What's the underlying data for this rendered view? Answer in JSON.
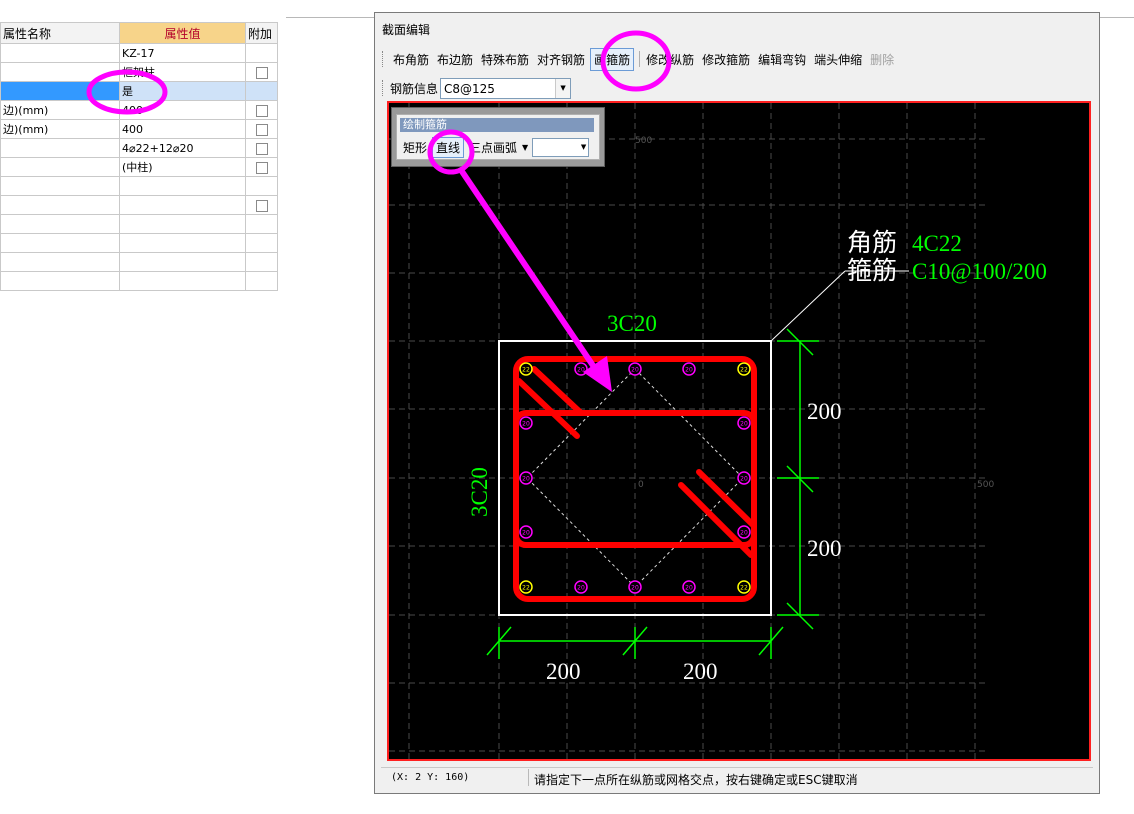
{
  "prop_grid": {
    "headers": {
      "name": "属性名称",
      "value": "属性值",
      "extra": "附加"
    },
    "rows": [
      {
        "name": "",
        "value": "KZ-17",
        "check": false
      },
      {
        "name": "",
        "value": "框架柱",
        "check": true
      },
      {
        "name": "",
        "value": "是",
        "check": false,
        "selected": true
      },
      {
        "name": "边)(mm)",
        "value": "400",
        "check": true
      },
      {
        "name": "边)(mm)",
        "value": "400",
        "check": true
      },
      {
        "name": "",
        "value": "4⌀22+12⌀20",
        "check": true
      },
      {
        "name": "",
        "value": "(中柱)",
        "check": true
      },
      {
        "name": "",
        "value": "",
        "check": false
      },
      {
        "name": "",
        "value": "",
        "check": true
      },
      {
        "name": "",
        "value": "",
        "check": false
      },
      {
        "name": "",
        "value": "",
        "check": false
      },
      {
        "name": "",
        "value": "",
        "check": false
      },
      {
        "name": "",
        "value": "",
        "check": false
      }
    ]
  },
  "dialog": {
    "title": "截面编辑",
    "toolbar": {
      "buttons": [
        "布角筋",
        "布边筋",
        "特殊布筋",
        "对齐钢筋",
        "画箍筋",
        "修改纵筋",
        "修改箍筋",
        "编辑弯钩",
        "端头伸缩",
        "删除"
      ],
      "active": "画箍筋",
      "disabled": "删除"
    },
    "rebar_info_label": "钢筋信息",
    "rebar_info_value": "C8@125",
    "draw_panel": {
      "title": "绘制箍筋",
      "rect_label": "矩形",
      "line_label": "直线",
      "arc_label": "三点画弧"
    },
    "drawing": {
      "corner_label": "角筋",
      "corner_value": "4C22",
      "stirrup_label": "箍筋",
      "stirrup_value": "C10@100/200",
      "top_side_rebar": "3C20",
      "left_side_rebar": "3C20",
      "dim_h1": "200",
      "dim_h2": "200",
      "dim_v1": "200",
      "dim_v2": "200",
      "grid_500_top": "500",
      "grid_0": "0",
      "grid_500_right": "500",
      "corner_bar_mark": "22",
      "side_bar_mark": "20"
    },
    "status": {
      "coord": "(X: 2 Y: 160)",
      "message": "请指定下一点所在纵筋或网格交点，按右键确定或ESC键取消"
    }
  },
  "colors": {
    "canvas": "#000000",
    "stirrup": "#ff0000",
    "dim": "#00ff00",
    "annotation": "#ff00ff",
    "corner_bar": "#ffff00",
    "side_bar": "#ff00ff"
  }
}
